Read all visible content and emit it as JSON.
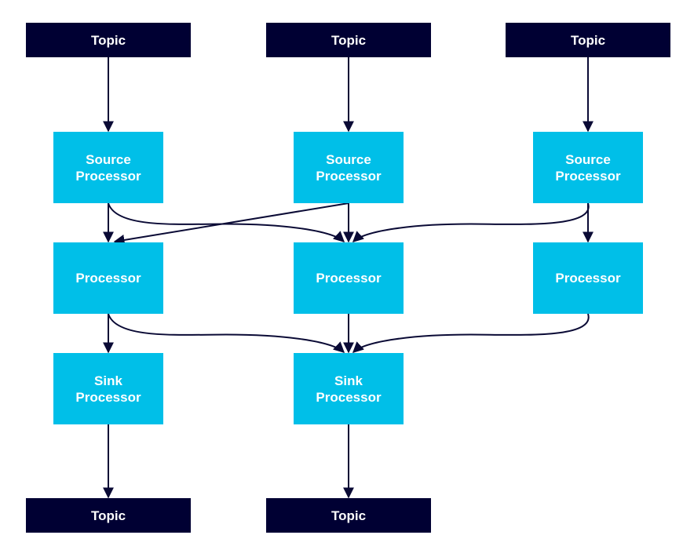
{
  "colors": {
    "topic": "#000033",
    "processor": "#00bfe8",
    "edge": "#0a0a35",
    "text": "#ffffff"
  },
  "nodes": {
    "topic_in_1": "Topic",
    "topic_in_2": "Topic",
    "topic_in_3": "Topic",
    "source_1": "Source Processor",
    "source_2": "Source Processor",
    "source_3": "Source Processor",
    "proc_1": "Processor",
    "proc_2": "Processor",
    "proc_3": "Processor",
    "sink_1": "Sink Processor",
    "sink_2": "Sink Processor",
    "topic_out_1": "Topic",
    "topic_out_2": "Topic"
  },
  "edges": [
    [
      "topic_in_1",
      "source_1"
    ],
    [
      "topic_in_2",
      "source_2"
    ],
    [
      "topic_in_3",
      "source_3"
    ],
    [
      "source_1",
      "proc_1"
    ],
    [
      "source_1",
      "proc_2"
    ],
    [
      "source_2",
      "proc_1"
    ],
    [
      "source_2",
      "proc_2"
    ],
    [
      "source_3",
      "proc_2"
    ],
    [
      "source_3",
      "proc_3"
    ],
    [
      "proc_1",
      "sink_1"
    ],
    [
      "proc_1",
      "sink_2"
    ],
    [
      "proc_2",
      "sink_2"
    ],
    [
      "proc_3",
      "sink_2"
    ],
    [
      "sink_1",
      "topic_out_1"
    ],
    [
      "sink_2",
      "topic_out_2"
    ]
  ]
}
